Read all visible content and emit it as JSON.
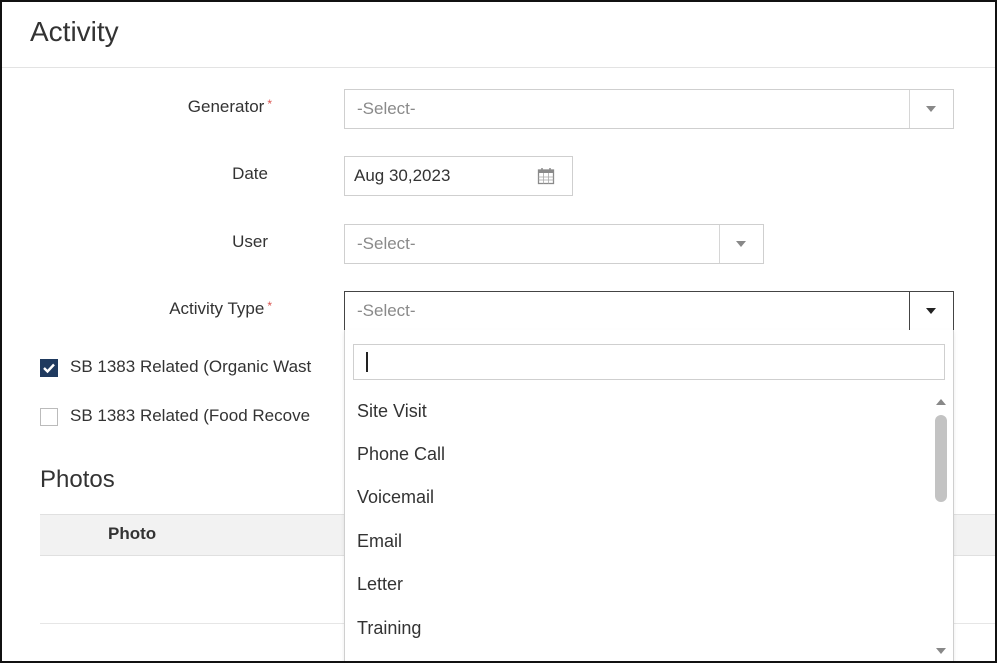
{
  "header": {
    "title": "Activity"
  },
  "form": {
    "generator": {
      "label": "Generator",
      "required_mark": "*",
      "value": "-Select-"
    },
    "date": {
      "label": "Date",
      "value": "Aug 30,2023",
      "icon": "calendar-icon"
    },
    "user": {
      "label": "User",
      "value": "-Select-"
    },
    "activity_type": {
      "label": "Activity Type",
      "required_mark": "*",
      "value": "-Select-"
    },
    "checks": [
      {
        "label": "SB 1383 Related (Organic Wast",
        "checked": true
      },
      {
        "label": "SB 1383 Related (Food Recove",
        "checked": false
      }
    ]
  },
  "photos": {
    "title": "Photos",
    "column": "Photo"
  },
  "dropdown": {
    "search_value": "",
    "options": [
      "Site Visit",
      "Phone Call",
      "Voicemail",
      "Email",
      "Letter",
      "Training"
    ]
  },
  "colors": {
    "required": "#d9534f",
    "checkbox_checked": "#1f3a5f"
  }
}
